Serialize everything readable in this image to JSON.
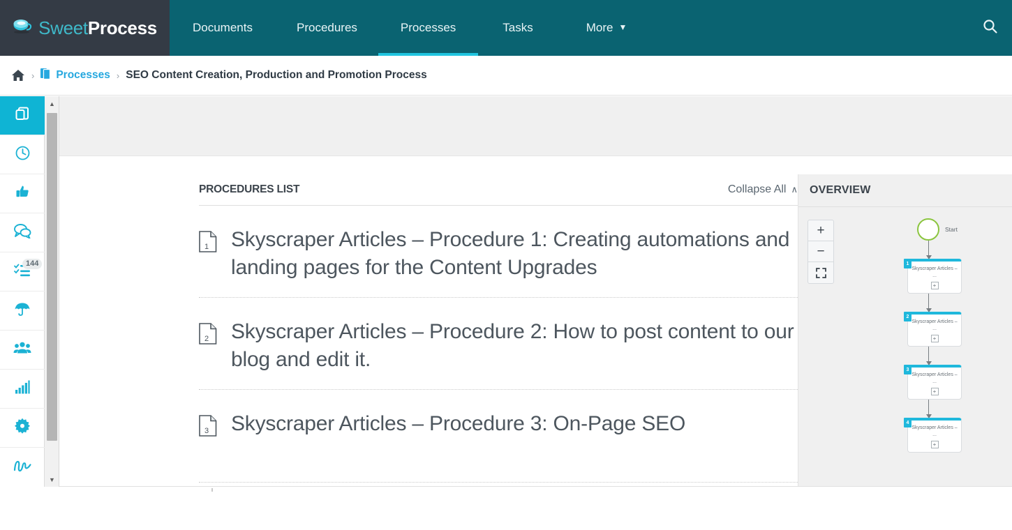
{
  "app": {
    "logo": {
      "icon": "coffee-cup-icon",
      "text_primary": "Sweet",
      "text_secondary": "Process"
    }
  },
  "topnav": {
    "items": [
      {
        "label": "Documents",
        "active": false
      },
      {
        "label": "Procedures",
        "active": false
      },
      {
        "label": "Processes",
        "active": true
      },
      {
        "label": "Tasks",
        "active": false
      },
      {
        "label": "More",
        "active": false,
        "caret": "▼"
      }
    ],
    "search_icon": "search-icon"
  },
  "breadcrumb": {
    "home_icon": "home-icon",
    "separator": "›",
    "link_icon": "documents-icon",
    "link_label": "Processes",
    "current_label": "SEO Content Creation, Production and Promotion Process"
  },
  "sidebar": {
    "items": [
      {
        "icon": "copy-documents-icon",
        "active": true,
        "badge": null
      },
      {
        "icon": "clock-icon",
        "active": false,
        "badge": null
      },
      {
        "icon": "thumbs-up-icon",
        "active": false,
        "badge": null
      },
      {
        "icon": "comments-icon",
        "active": false,
        "badge": null
      },
      {
        "icon": "checklist-icon",
        "active": false,
        "badge": "144"
      },
      {
        "icon": "umbrella-icon",
        "active": false,
        "badge": null
      },
      {
        "icon": "users-icon",
        "active": false,
        "badge": null
      },
      {
        "icon": "bar-chart-icon",
        "active": false,
        "badge": null
      },
      {
        "icon": "badge-star-icon",
        "active": false,
        "badge": null
      },
      {
        "icon": "signature-icon",
        "active": false,
        "badge": null
      }
    ],
    "scroll_up_icon": "▲",
    "scroll_down_icon": "▼"
  },
  "procedures_panel": {
    "title": "PROCEDURES LIST",
    "collapse_all_label": "Collapse All",
    "collapse_all_caret": "∧",
    "items": [
      {
        "number": "1",
        "title": "Skyscraper Articles – Procedure 1: Creating automations and landing pages for the Content Upgrades"
      },
      {
        "number": "2",
        "title": "Skyscraper Articles – Procedure 2: How to post content to our blog and edit it."
      },
      {
        "number": "3",
        "title": "Skyscraper Articles – Procedure 3: On-Page SEO"
      }
    ]
  },
  "overview_panel": {
    "title": "OVERVIEW",
    "zoom_controls": [
      {
        "label": "+",
        "name": "zoom-in-button"
      },
      {
        "label": "−",
        "name": "zoom-out-button"
      },
      {
        "label": "fit",
        "name": "fit-screen-button"
      }
    ],
    "flowchart": {
      "start_label": "Start",
      "nodes": [
        {
          "number": "1",
          "label": "Skyscraper Articles – ...",
          "expand": "+"
        },
        {
          "number": "2",
          "label": "Skyscraper Articles – ...",
          "expand": "+"
        },
        {
          "number": "3",
          "label": "Skyscraper Articles – ...",
          "expand": "+"
        },
        {
          "number": "4",
          "label": "Skyscraper Articles – ...",
          "expand": "+"
        }
      ]
    }
  },
  "colors": {
    "logo_bg": "#343b45",
    "nav_bg": "#0a6371",
    "accent_cyan": "#0fb4d4",
    "active_underline": "#20c5e0",
    "link_blue": "#26a8df",
    "start_green": "#8bc53f"
  }
}
